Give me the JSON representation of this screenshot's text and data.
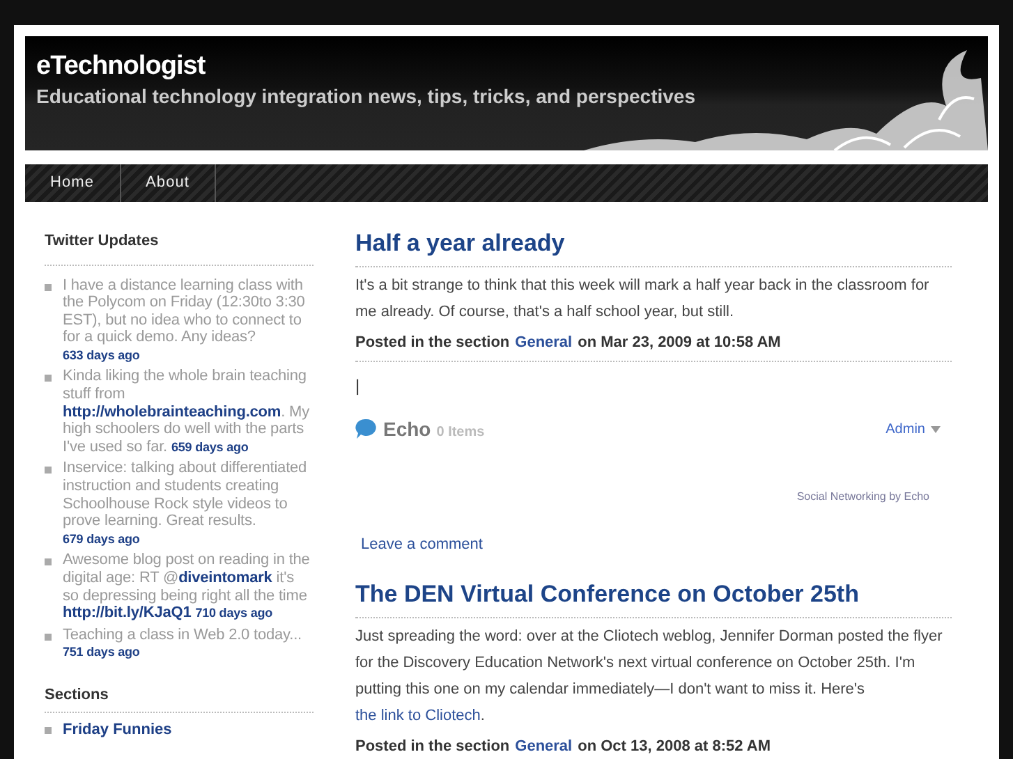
{
  "header": {
    "title": "eTechnologist",
    "tagline": "Educational technology integration news, tips, tricks, and perspectives"
  },
  "nav": [
    {
      "label": "Home",
      "selected": false
    },
    {
      "label": "About",
      "selected": false
    }
  ],
  "sidebar": {
    "twitter": {
      "heading": "Twitter Updates",
      "tweets": [
        {
          "parts": [
            {
              "kind": "text",
              "text": "I have a distance learning class with the Polycom on Friday (12:30to 3:30 EST), but no idea who to connect to for a quick demo. Any ideas?"
            }
          ],
          "age": "633 days ago"
        },
        {
          "parts": [
            {
              "kind": "text",
              "text": "Kinda liking the whole brain teaching stuff from "
            },
            {
              "kind": "link",
              "text": "http://wholebrainteaching.com"
            },
            {
              "kind": "text",
              "text": ". My high schoolers do well with the parts I've used so far."
            }
          ],
          "age": "659 days ago"
        },
        {
          "parts": [
            {
              "kind": "text",
              "text": "Inservice: talking about differentiated instruction and students creating Schoolhouse Rock style videos to prove learning. Great results."
            }
          ],
          "age": "679 days ago"
        },
        {
          "parts": [
            {
              "kind": "text",
              "text": "Awesome blog post on reading in the digital age: RT @"
            },
            {
              "kind": "link",
              "text": "diveintomark"
            },
            {
              "kind": "text",
              "text": " it's so depressing being right all the time "
            },
            {
              "kind": "link",
              "text": "http://bit.ly/KJaQ1"
            }
          ],
          "age": "710 days ago"
        },
        {
          "parts": [
            {
              "kind": "text",
              "text": "Teaching a class in Web 2.0 today..."
            }
          ],
          "age": "751 days ago"
        }
      ]
    },
    "sections": {
      "heading": "Sections",
      "items": [
        "Friday Funnies"
      ]
    }
  },
  "posts": [
    {
      "title": "Half a year already",
      "body": [
        {
          "kind": "text",
          "text": "It's a bit strange to think that this week will mark a half year back in the classroom for me already. Of course, that's a half school year, but still."
        }
      ],
      "meta": {
        "prefix": "Posted in the section",
        "section": "General",
        "suffix": "on Mar 23, 2009 at 10:58 AM"
      },
      "cursor": "|",
      "echo": {
        "name": "Echo",
        "count": "0 Items",
        "admin": "Admin",
        "credit": "Social Networking by Echo"
      },
      "comment_link": "Leave a comment"
    },
    {
      "title": "The DEN Virtual Conference on October 25th",
      "body": [
        {
          "kind": "text",
          "text": "Just spreading the word: over at the Cliotech weblog, Jennifer Dorman posted the flyer for the Discovery Education Network's next virtual conference on October 25th. I'm putting this one on my calendar immediately—I don't want to miss it. Here's "
        },
        {
          "kind": "link",
          "text": "the link to Cliotech"
        },
        {
          "kind": "text",
          "text": "."
        }
      ],
      "meta": {
        "prefix": "Posted in the section",
        "section": "General",
        "suffix": "on Oct 13, 2008 at 8:52 AM"
      }
    }
  ]
}
